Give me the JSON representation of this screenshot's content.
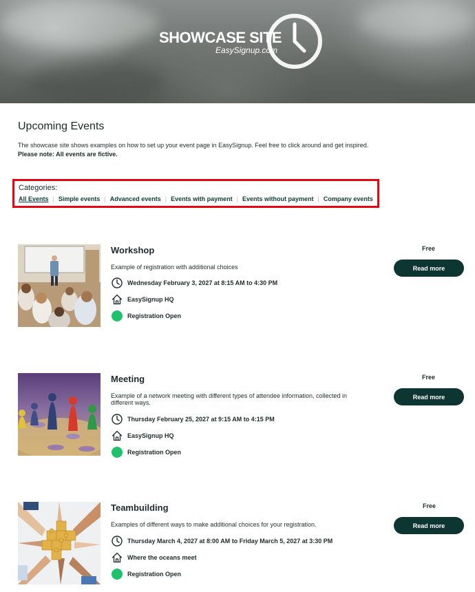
{
  "hero": {
    "title": "SHOWCASE SITE",
    "subtitle": "EasySignup.com"
  },
  "intro": {
    "title": "Upcoming Events",
    "text": "The showcase site shows examples on how to set up your event page in EasySignup. Feel free to click around and get inspired.",
    "note": "Please note: All events are fictive."
  },
  "categories": {
    "label": "Categories:",
    "items": [
      "All Events",
      "Simple events",
      "Advanced events",
      "Events with payment",
      "Events without payment",
      "Company events"
    ],
    "active": "All Events"
  },
  "events": [
    {
      "title": "Workshop",
      "description": "Example of registration with additional choices",
      "date": "Wednesday February 3, 2027 at 8:15 AM to 4:30 PM",
      "location": "EasySignup HQ",
      "status": "Registration Open",
      "price": "Free",
      "button": "Read more"
    },
    {
      "title": "Meeting",
      "description": "Example of a network meeting with different types of attendee information, collected in different ways.",
      "date": "Thursday February 25, 2027 at 9:15 AM to 4:15 PM",
      "location": "EasySignup HQ",
      "status": "Registration Open",
      "price": "Free",
      "button": "Read more"
    },
    {
      "title": "Teambuilding",
      "description": "Examples of different ways to make additional choices for your registration.",
      "date": "Thursday March 4, 2027 at 8:00 AM to Friday March 5, 2027 at 3:30 PM",
      "location": "Where the oceans meet",
      "status": "Registration Open",
      "price": "Free",
      "button": "Read more"
    }
  ],
  "colors": {
    "accent": "#0d3531",
    "status_open": "#1fc16b",
    "highlight_border": "#e30613"
  },
  "icons": {
    "date": "clock-icon",
    "location": "house-icon",
    "status": "status-dot",
    "logo": "clock-icon"
  }
}
